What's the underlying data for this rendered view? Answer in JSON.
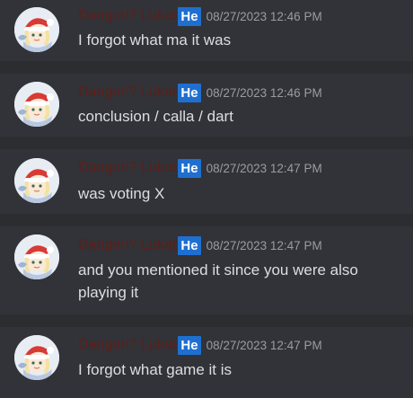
{
  "messages": [
    {
      "author": "Danger!? Lukat",
      "tag": "He",
      "timestamp": "08/27/2023 12:46 PM",
      "text": "I forgot what ma it was"
    },
    {
      "author": "Danger!? Lukat",
      "tag": "He",
      "timestamp": "08/27/2023 12:46 PM",
      "text": "conclusion / calla / dart"
    },
    {
      "author": "Danger!? Lukat",
      "tag": "He",
      "timestamp": "08/27/2023 12:47 PM",
      "text": "was voting X"
    },
    {
      "author": "Danger!? Lukat",
      "tag": "He",
      "timestamp": "08/27/2023 12:47 PM",
      "text": "and you mentioned it since you were also playing it"
    },
    {
      "author": "Danger!? Lukat",
      "tag": "He",
      "timestamp": "08/27/2023 12:47 PM",
      "text": "I forgot what game it is"
    }
  ],
  "colors": {
    "background": "#313338",
    "separator": "#2b2d31",
    "author": "#5c1f1a",
    "tag": "#1f6fd0",
    "timestamp": "#9a9ca3",
    "text": "#dbdee1"
  },
  "icons": {
    "avatar": "santa-hat-character-avatar"
  }
}
